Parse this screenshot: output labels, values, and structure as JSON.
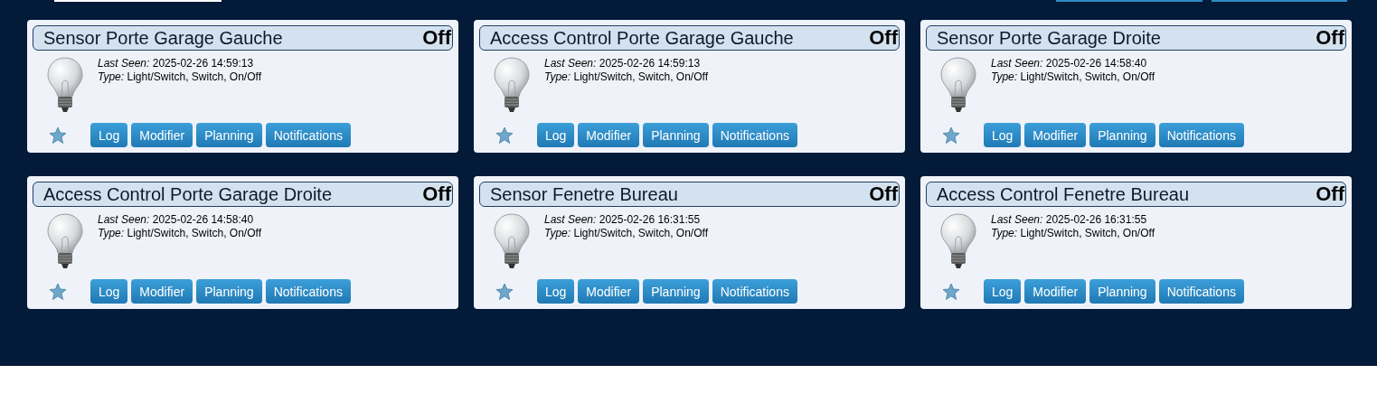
{
  "devices": [
    {
      "name": "Sensor Porte Garage Gauche",
      "status": "Off",
      "last_seen_label": "Last Seen:",
      "last_seen": "2025-02-26 14:59:13",
      "type_label": "Type:",
      "type": "Light/Switch, Switch, On/Off",
      "buttons": [
        "Log",
        "Modifier",
        "Planning",
        "Notifications"
      ]
    },
    {
      "name": "Access Control Porte Garage Gauche",
      "status": "Off",
      "last_seen_label": "Last Seen:",
      "last_seen": "2025-02-26 14:59:13",
      "type_label": "Type:",
      "type": "Light/Switch, Switch, On/Off",
      "buttons": [
        "Log",
        "Modifier",
        "Planning",
        "Notifications"
      ]
    },
    {
      "name": "Sensor Porte Garage Droite",
      "status": "Off",
      "last_seen_label": "Last Seen:",
      "last_seen": "2025-02-26 14:58:40",
      "type_label": "Type:",
      "type": "Light/Switch, Switch, On/Off",
      "buttons": [
        "Log",
        "Modifier",
        "Planning",
        "Notifications"
      ]
    },
    {
      "name": "Access Control Porte Garage Droite",
      "status": "Off",
      "last_seen_label": "Last Seen:",
      "last_seen": "2025-02-26 14:58:40",
      "type_label": "Type:",
      "type": "Light/Switch, Switch, On/Off",
      "buttons": [
        "Log",
        "Modifier",
        "Planning",
        "Notifications"
      ]
    },
    {
      "name": "Sensor Fenetre Bureau",
      "status": "Off",
      "last_seen_label": "Last Seen:",
      "last_seen": "2025-02-26 16:31:55",
      "type_label": "Type:",
      "type": "Light/Switch, Switch, On/Off",
      "buttons": [
        "Log",
        "Modifier",
        "Planning",
        "Notifications"
      ]
    },
    {
      "name": "Access Control Fenetre Bureau",
      "status": "Off",
      "last_seen_label": "Last Seen:",
      "last_seen": "2025-02-26 16:31:55",
      "type_label": "Type:",
      "type": "Light/Switch, Switch, On/Off",
      "buttons": [
        "Log",
        "Modifier",
        "Planning",
        "Notifications"
      ]
    }
  ]
}
